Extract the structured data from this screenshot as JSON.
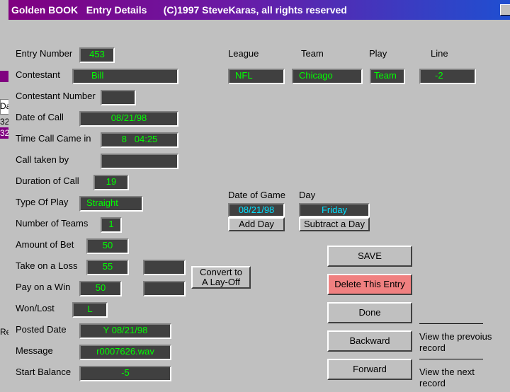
{
  "window": {
    "title": "Golden BOOK   Entry Details      (C)1997 SteveKaras, all rights reserved"
  },
  "background": {
    "fragments": [
      "Da",
      "32",
      "32",
      "Re"
    ]
  },
  "labels": {
    "entry_number": "Entry Number",
    "contestant": "Contestant",
    "contestant_number": "Contestant Number",
    "date_of_call": "Date of Call",
    "time_call_came_in": "Time Call Came in",
    "call_taken_by": "Call taken by",
    "duration_of_call": "Duration of Call",
    "type_of_play": "Type Of Play",
    "number_of_teams": "Number of Teams",
    "amount_of_bet": "Amount of Bet",
    "take_on_a_loss": "Take on a Loss",
    "pay_on_a_win": "Pay on a Win",
    "won_lost": "Won/Lost",
    "posted_date": "Posted Date",
    "message": "Message",
    "start_balance": "Start Balance",
    "league": "League",
    "team": "Team",
    "play": "Play",
    "line": "Line",
    "date_of_game": "Date of  Game",
    "day": "Day"
  },
  "values": {
    "entry_number": "453",
    "contestant": "Bill",
    "contestant_number": "",
    "date_of_call": "08/21/98",
    "time_call_came_in": "8   04:25",
    "call_taken_by": "",
    "duration_of_call": "19",
    "type_of_play": "Straight",
    "number_of_teams": "1",
    "amount_of_bet": "50",
    "take_on_a_loss": "55",
    "take_on_a_loss_extra": "",
    "pay_on_a_win": "50",
    "pay_on_a_win_extra": "",
    "won_lost": "L",
    "posted_date": "Y 08/21/98",
    "message": "r0007626.wav",
    "start_balance": "-5",
    "league": "NFL",
    "team": "Chicago",
    "play": "Team",
    "line": "-2",
    "date_of_game": "08/21/98",
    "day": "Friday"
  },
  "buttons": {
    "add_day": "Add Day",
    "subtract_day": "Subtract a Day",
    "convert_line1": "Convert to",
    "convert_line2": "A Lay-Off",
    "save": "SAVE",
    "delete": "Delete This Entry",
    "done": "Done",
    "backward": "Backward",
    "forward": "Forward"
  },
  "hints": {
    "previous_line1": "View the prevoius",
    "previous_line2": "record",
    "next_line1": "View the next",
    "next_line2": "record"
  },
  "colors": {
    "field_bg": "#404040",
    "field_text": "#00ff00",
    "date_field_text": "#00e0ff",
    "delete_button": "#f08080"
  }
}
